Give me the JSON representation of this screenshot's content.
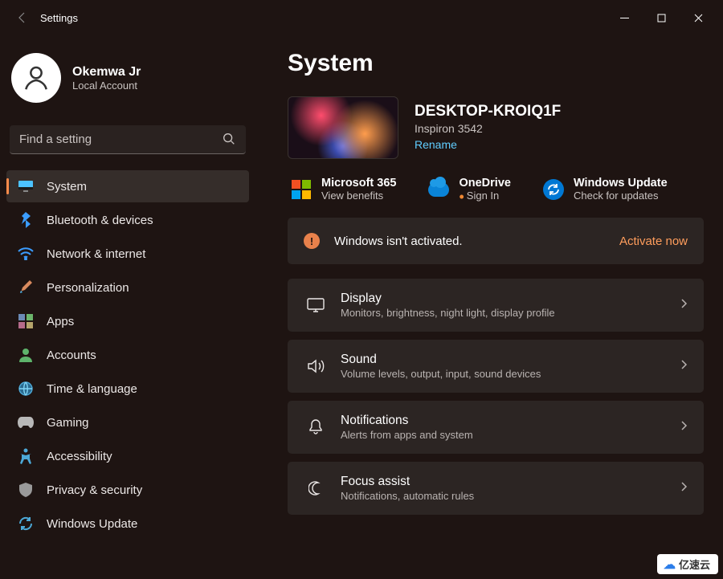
{
  "app": {
    "title": "Settings"
  },
  "user": {
    "name": "Okemwa Jr",
    "account_type": "Local Account"
  },
  "search": {
    "placeholder": "Find a setting"
  },
  "sidebar": {
    "items": [
      {
        "label": "System",
        "icon": "display"
      },
      {
        "label": "Bluetooth & devices",
        "icon": "bluetooth"
      },
      {
        "label": "Network & internet",
        "icon": "wifi"
      },
      {
        "label": "Personalization",
        "icon": "brush"
      },
      {
        "label": "Apps",
        "icon": "apps"
      },
      {
        "label": "Accounts",
        "icon": "person"
      },
      {
        "label": "Time & language",
        "icon": "globe"
      },
      {
        "label": "Gaming",
        "icon": "gamepad"
      },
      {
        "label": "Accessibility",
        "icon": "accessibility"
      },
      {
        "label": "Privacy & security",
        "icon": "shield"
      },
      {
        "label": "Windows Update",
        "icon": "update"
      }
    ],
    "selected_index": 0
  },
  "page": {
    "title": "System",
    "device": {
      "name": "DESKTOP-KROIQ1F",
      "model": "Inspiron 3542",
      "rename_label": "Rename"
    },
    "promos": [
      {
        "title": "Microsoft 365",
        "sub": "View benefits"
      },
      {
        "title": "OneDrive",
        "sub": "Sign In",
        "dot": true
      },
      {
        "title": "Windows Update",
        "sub": "Check for updates"
      }
    ],
    "activation": {
      "message": "Windows isn't activated.",
      "action": "Activate now"
    },
    "items": [
      {
        "title": "Display",
        "sub": "Monitors, brightness, night light, display profile"
      },
      {
        "title": "Sound",
        "sub": "Volume levels, output, input, sound devices"
      },
      {
        "title": "Notifications",
        "sub": "Alerts from apps and system"
      },
      {
        "title": "Focus assist",
        "sub": "Notifications, automatic rules"
      }
    ]
  },
  "watermark": "亿速云"
}
